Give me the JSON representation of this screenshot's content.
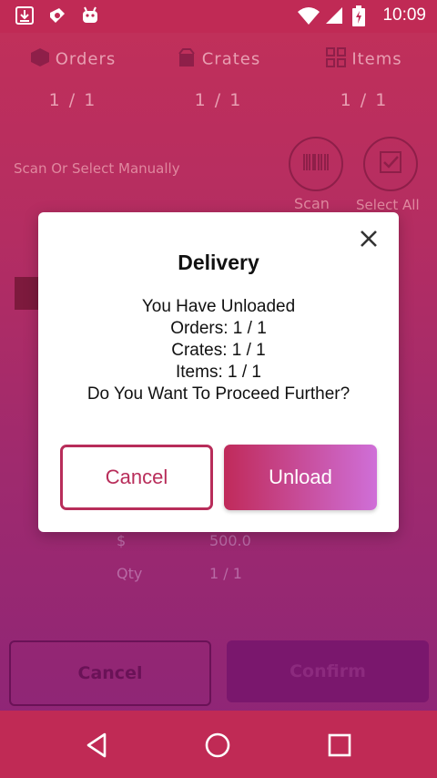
{
  "status_bar": {
    "time": "10:09",
    "left_icons": [
      "download-icon",
      "app-icon",
      "android-icon"
    ],
    "right_icons": [
      "wifi-icon",
      "signal-icon",
      "battery-charging-icon"
    ]
  },
  "background": {
    "summary": [
      {
        "label": "Orders",
        "value": "1 / 1",
        "icon": "cube-icon"
      },
      {
        "label": "Crates",
        "value": "1 / 1",
        "icon": "crate-icon"
      },
      {
        "label": "Items",
        "value": "1 / 1",
        "icon": "grid-icon"
      }
    ],
    "scan_hint": "Scan Or Select Manually",
    "scan_label": "Scan",
    "select_all_label": "Select All",
    "rows": [
      {
        "label": "$",
        "value": "500.0"
      },
      {
        "label": "Qty",
        "value": "1 / 1"
      }
    ],
    "cancel_label": "Cancel",
    "confirm_label": "Confirm"
  },
  "dialog": {
    "title": "Delivery",
    "message_lines": [
      "You Have Unloaded",
      "Orders: 1 / 1",
      "Crates: 1 / 1",
      "Items: 1 / 1",
      "Do You Want To Proceed Further?"
    ],
    "cancel_label": "Cancel",
    "unload_label": "Unload"
  },
  "colors": {
    "accent": "#c02a55",
    "gradient_end": "#cf6fd8",
    "dialog_bg": "#ffffff"
  }
}
